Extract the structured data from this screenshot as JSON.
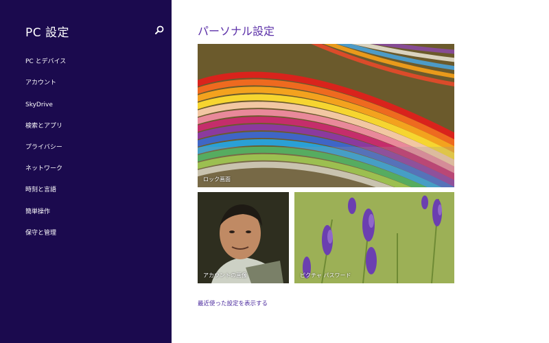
{
  "sidebar": {
    "title": "PC 設定",
    "search_icon": "search-icon",
    "items": [
      {
        "label": "PC とデバイス"
      },
      {
        "label": "アカウント"
      },
      {
        "label": "SkyDrive"
      },
      {
        "label": "検索とアプリ"
      },
      {
        "label": "プライバシー"
      },
      {
        "label": "ネットワーク"
      },
      {
        "label": "時刻と言語"
      },
      {
        "label": "簡単操作"
      },
      {
        "label": "保守と管理"
      }
    ]
  },
  "main": {
    "title": "パーソナル設定",
    "tiles": {
      "lock_screen": {
        "label": "ロック画面"
      },
      "account_picture": {
        "label": "アカウントの画像"
      },
      "picture_password": {
        "label": "ピクチャ パスワード"
      }
    },
    "recent_link": "最近使った設定を表示する"
  },
  "colors": {
    "sidebar_bg": "#1b0a4e",
    "accent": "#5b2fa8",
    "link": "#4b2a9e"
  }
}
